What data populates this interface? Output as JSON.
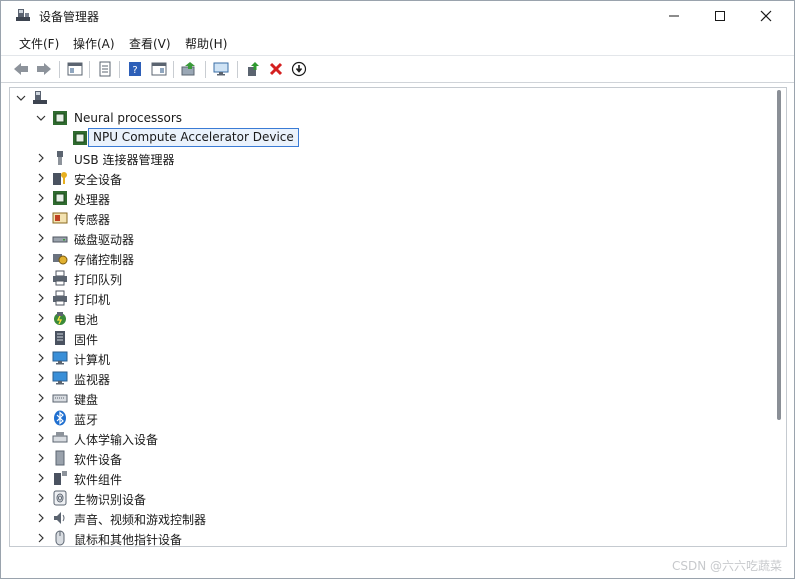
{
  "window": {
    "title": "设备管理器"
  },
  "menu": [
    "文件(F)",
    "操作(A)",
    "查看(V)",
    "帮助(H)"
  ],
  "toolbar": {
    "buttons": [
      "back-icon",
      "forward-icon",
      "show-hide-console-tree-icon",
      "properties-icon",
      "help-icon",
      "action-pane-icon",
      "update-driver-icon",
      "scan-hardware-icon",
      "enable-device-icon",
      "uninstall-device-icon",
      "disable-device-icon"
    ]
  },
  "tree": {
    "root": "",
    "items": [
      {
        "label": "Neural processors",
        "icon": "chip-icon",
        "expanded": true
      },
      {
        "label": "NPU Compute Accelerator Device",
        "icon": "chip-icon",
        "selected": true
      },
      {
        "label": "USB 连接器管理器",
        "icon": "usb-icon"
      },
      {
        "label": "安全设备",
        "icon": "security-key-icon"
      },
      {
        "label": "处理器",
        "icon": "processor-icon"
      },
      {
        "label": "传感器",
        "icon": "sensor-icon"
      },
      {
        "label": "磁盘驱动器",
        "icon": "disk-drive-icon"
      },
      {
        "label": "存储控制器",
        "icon": "storage-controller-icon"
      },
      {
        "label": "打印队列",
        "icon": "print-queue-icon"
      },
      {
        "label": "打印机",
        "icon": "printer-icon"
      },
      {
        "label": "电池",
        "icon": "battery-icon"
      },
      {
        "label": "固件",
        "icon": "firmware-icon"
      },
      {
        "label": "计算机",
        "icon": "computer-icon"
      },
      {
        "label": "监视器",
        "icon": "monitor-icon"
      },
      {
        "label": "键盘",
        "icon": "keyboard-icon"
      },
      {
        "label": "蓝牙",
        "icon": "bluetooth-icon"
      },
      {
        "label": "人体学输入设备",
        "icon": "hid-icon"
      },
      {
        "label": "软件设备",
        "icon": "software-device-icon"
      },
      {
        "label": "软件组件",
        "icon": "software-component-icon"
      },
      {
        "label": "生物识别设备",
        "icon": "fingerprint-icon"
      },
      {
        "label": "声音、视频和游戏控制器",
        "icon": "speaker-icon"
      },
      {
        "label": "鼠标和其他指针设备",
        "icon": "mouse-icon"
      }
    ]
  },
  "watermark": "CSDN @六六吃蔬菜"
}
